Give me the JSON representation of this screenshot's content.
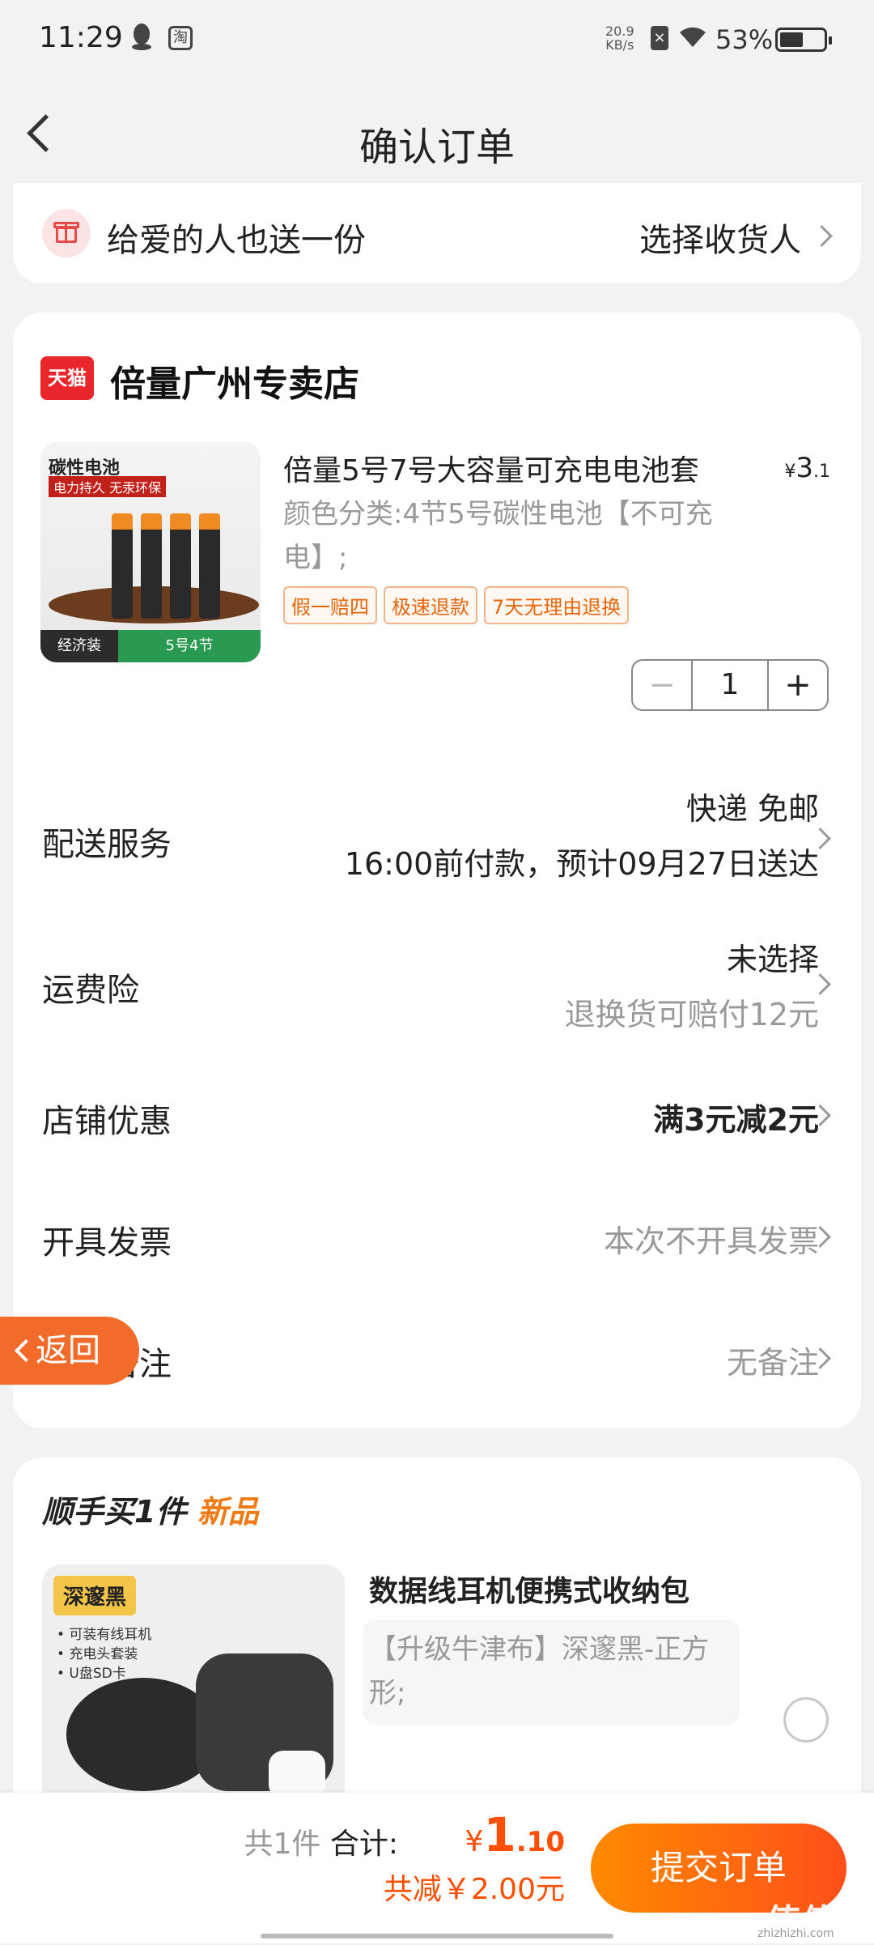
{
  "status_bar": {
    "time": "11:29",
    "net_speed_value": "20.9",
    "net_speed_unit": "KB/s",
    "battery_percent": "53%",
    "battery_level": 0.53
  },
  "nav": {
    "title": "确认订单"
  },
  "gift": {
    "text": "给爱的人也送一份",
    "action": "选择收货人"
  },
  "store": {
    "logo_text": "天猫",
    "name": "倍量广州专卖店"
  },
  "product": {
    "image_label_1": "碳性电池",
    "image_label_2": "电力持久 无汞环保",
    "image_footer_left": "经济装",
    "image_footer_right": "5号4节",
    "title": "倍量5号7号大容量可充电电池套",
    "price_symbol": "¥",
    "price_int": "3",
    "price_dec": ".1",
    "sku": "颜色分类:4节5号碳性电池【不可充电】;",
    "tags": [
      "假一赔四",
      "极速退款",
      "7天无理由退换"
    ],
    "quantity": "1",
    "minus": "−",
    "plus": "+"
  },
  "rows": {
    "delivery": {
      "label": "配送服务",
      "line1": "快递 免邮",
      "line2": "16:00前付款，预计09月27日送达"
    },
    "insurance": {
      "label": "运费险",
      "line1": "未选择",
      "line2": "退换货可赔付12元"
    },
    "coupon": {
      "label": "店铺优惠",
      "value": "满3元减2元"
    },
    "invoice": {
      "label": "开具发票",
      "value": "本次不开具发票"
    },
    "remark": {
      "label": "订单备注",
      "value": "无备注"
    }
  },
  "float_back": {
    "label": "返回"
  },
  "recommend": {
    "title_prefix": "顺手买1件",
    "title_new": "新品",
    "image_tag": "深邃黑",
    "image_lines": [
      "• 可装有线耳机",
      "• 充电头套装",
      "• U盘SD卡"
    ],
    "name": "数据线耳机便携式收纳包",
    "sku": "【升级牛津布】深邃黑-正方形;"
  },
  "bottom": {
    "count_text": "共1件",
    "total_label": "合计:",
    "currency": "¥",
    "total_int": "1",
    "total_dec": ".10",
    "discount": "共减￥2.00元",
    "submit": "提交订单"
  },
  "watermark": {
    "text": "值值值",
    "sub": "zhizhizhi.com"
  },
  "colors": {
    "accent": "#ff4f00",
    "tmall_red": "#e8262b",
    "new_orange": "#f07a14"
  }
}
